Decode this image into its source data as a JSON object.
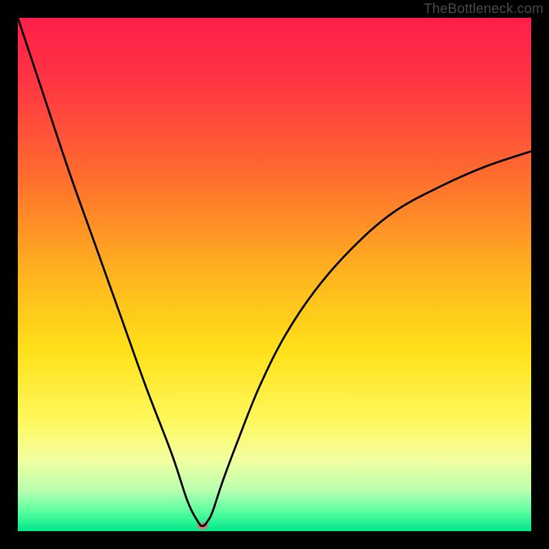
{
  "watermark": "TheBottleneck.com",
  "chart_data": {
    "type": "line",
    "title": "",
    "xlabel": "",
    "ylabel": "",
    "xlim": [
      0,
      100
    ],
    "ylim": [
      0,
      100
    ],
    "grid": false,
    "legend": false,
    "background": {
      "type": "vertical-gradient",
      "stops": [
        {
          "pos": 0.0,
          "color": "#ff1f4b"
        },
        {
          "pos": 0.12,
          "color": "#ff3443"
        },
        {
          "pos": 0.3,
          "color": "#ff6a2f"
        },
        {
          "pos": 0.5,
          "color": "#ffb41f"
        },
        {
          "pos": 0.65,
          "color": "#ffe11a"
        },
        {
          "pos": 0.78,
          "color": "#fff75a"
        },
        {
          "pos": 0.86,
          "color": "#f3ff9f"
        },
        {
          "pos": 0.92,
          "color": "#b9ffb0"
        },
        {
          "pos": 0.96,
          "color": "#5dffa0"
        },
        {
          "pos": 1.0,
          "color": "#00e88a"
        }
      ]
    },
    "series": [
      {
        "name": "bottleneck-curve",
        "color": "#000000",
        "x": [
          0,
          5,
          10,
          15,
          20,
          25,
          30,
          33,
          35,
          36,
          37,
          38,
          40,
          43,
          47,
          52,
          58,
          65,
          73,
          82,
          91,
          100
        ],
        "y": [
          100,
          85,
          70,
          56,
          42,
          28,
          15,
          6,
          2,
          1,
          2,
          4,
          10,
          18,
          28,
          38,
          47,
          55,
          62,
          67,
          71,
          74
        ]
      }
    ],
    "marker": {
      "name": "optimal-point",
      "x": 36,
      "y": 1,
      "color": "#c97b78",
      "rx": 8,
      "ry": 5
    }
  }
}
